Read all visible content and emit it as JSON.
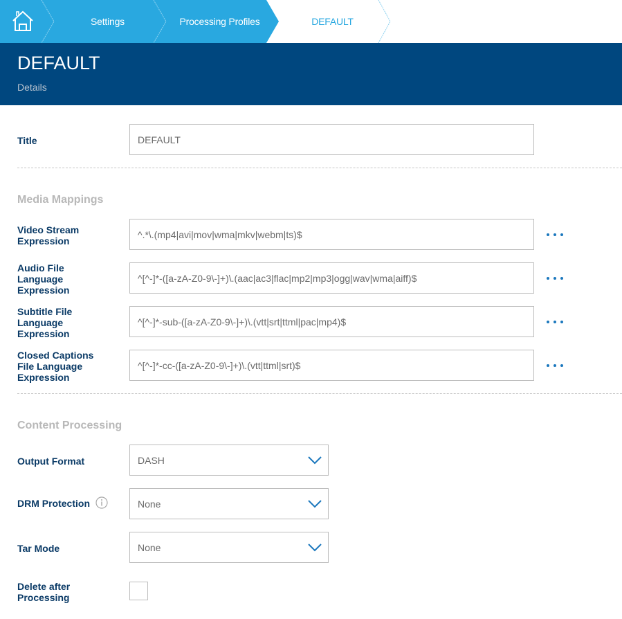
{
  "breadcrumb": {
    "home_icon": "home-icon",
    "items": [
      {
        "label": "Settings"
      },
      {
        "label": "Processing Profiles"
      },
      {
        "label": "DEFAULT"
      }
    ],
    "colors": {
      "active_bg": "#29a8e0",
      "current_text": "#29a8e0"
    }
  },
  "header": {
    "title": "DEFAULT",
    "subtitle": "Details",
    "bg_color": "#00477f"
  },
  "form": {
    "title": {
      "label": "Title",
      "value": "DEFAULT"
    },
    "media_mappings": {
      "section_title": "Media Mappings",
      "fields": [
        {
          "label_lines": [
            "Video Stream",
            "Expression"
          ],
          "value": "^.*\\.(mp4|avi|mov|wma|mkv|webm|ts)$",
          "more_icon": "ellipsis-icon"
        },
        {
          "label_lines": [
            "Audio File",
            "Language",
            "Expression"
          ],
          "value": "^[^-]*-([a-zA-Z0-9\\-]+)\\.(aac|ac3|flac|mp2|mp3|ogg|wav|wma|aiff)$",
          "more_icon": "ellipsis-icon"
        },
        {
          "label_lines": [
            "Subtitle File",
            "Language",
            "Expression"
          ],
          "value": "^[^-]*-sub-([a-zA-Z0-9\\-]+)\\.(vtt|srt|ttml|pac|mp4)$",
          "more_icon": "ellipsis-icon"
        },
        {
          "label_lines": [
            "Closed Captions",
            "File Language",
            "Expression"
          ],
          "value": "^[^-]*-cc-([a-zA-Z0-9\\-]+)\\.(vtt|ttml|srt)$",
          "more_icon": "ellipsis-icon"
        }
      ]
    },
    "content_processing": {
      "section_title": "Content Processing",
      "output_format": {
        "label": "Output Format",
        "value": "DASH"
      },
      "drm_protection": {
        "label": "DRM Protection",
        "value": "None",
        "info_icon": "info-icon"
      },
      "tar_mode": {
        "label": "Tar Mode",
        "value": "None"
      },
      "delete_after_processing": {
        "label_lines": [
          "Delete after",
          "Processing"
        ],
        "checked": false
      }
    }
  }
}
